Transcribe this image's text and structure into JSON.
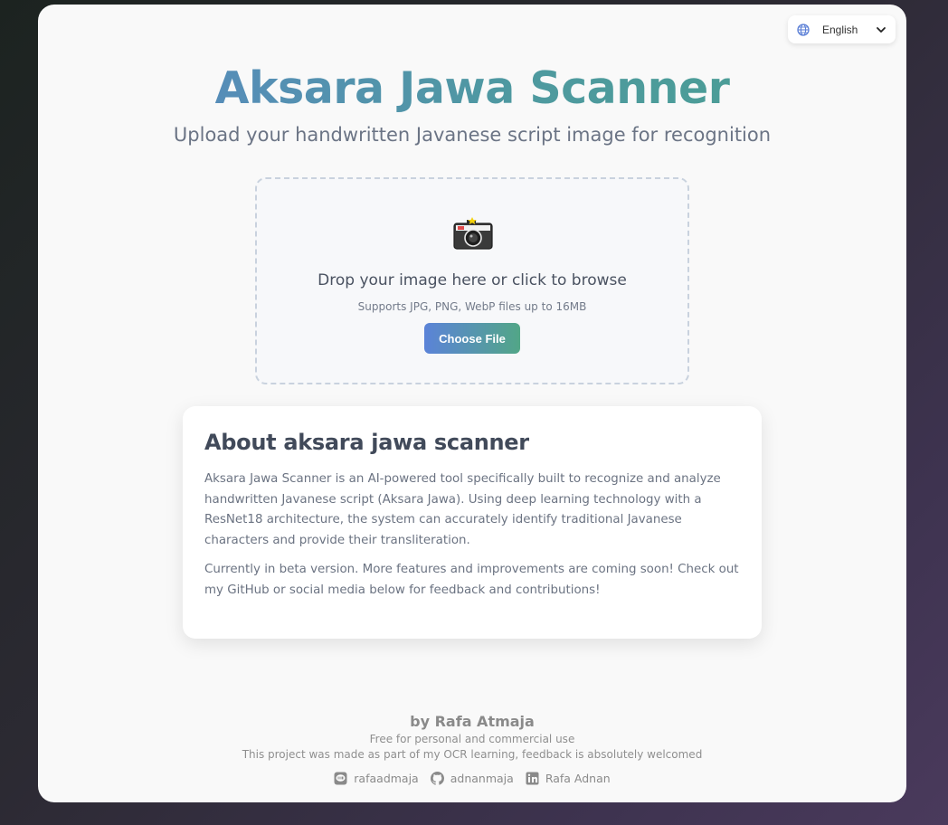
{
  "language": {
    "selected": "English"
  },
  "header": {
    "title": "Aksara Jawa Scanner",
    "subtitle": "Upload your handwritten Javanese script image for recognition"
  },
  "upload": {
    "icon": "camera-icon",
    "prompt": "Drop your image here or click to browse",
    "hint": "Supports JPG, PNG, WebP files up to 16MB",
    "button_label": "Choose File"
  },
  "about": {
    "heading": "About aksara jawa scanner",
    "paragraph1": "Aksara Jawa Scanner is an AI-powered tool specifically built to recognize and analyze handwritten Javanese script (Aksara Jawa). Using deep learning technology with a ResNet18 architecture, the system can accurately identify traditional Javanese characters and provide their transliteration.",
    "paragraph2": "Currently in beta version. More features and improvements are coming soon! Check out my GitHub or social media below for feedback and contributions!"
  },
  "footer": {
    "author": "by Rafa Atmaja",
    "license": "Free for personal and commercial use",
    "note": "This project was made as part of my OCR learning, feedback is absolutely welcomed",
    "socials": [
      {
        "icon": "line-icon",
        "label": "rafaadmaja"
      },
      {
        "icon": "github-icon",
        "label": "adnanmaja"
      },
      {
        "icon": "linkedin-icon",
        "label": "Rafa Adnan"
      }
    ]
  },
  "colors": {
    "title_gradient_start": "#5b86c6",
    "title_gradient_end": "#4aa090",
    "button_gradient_start": "#5b83d8",
    "button_gradient_end": "#52a687"
  }
}
